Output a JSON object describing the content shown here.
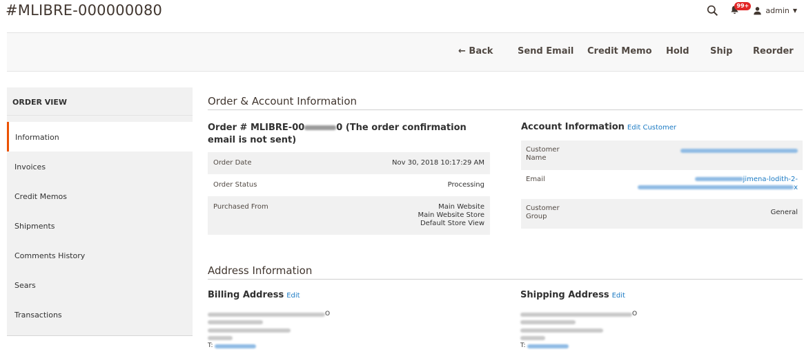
{
  "header": {
    "title": "#MLIBRE-000000080",
    "notification_count": "99+",
    "user_name": "admin",
    "icons": [
      "search-icon",
      "bell-icon",
      "user-icon",
      "caret-down-icon"
    ]
  },
  "toolbar": {
    "back": "Back",
    "send_email": "Send Email",
    "credit_memo": "Credit Memo",
    "hold": "Hold",
    "ship": "Ship",
    "reorder": "Reorder"
  },
  "sidebar": {
    "heading": "ORDER VIEW",
    "items": [
      {
        "label": "Information",
        "active": true
      },
      {
        "label": "Invoices"
      },
      {
        "label": "Credit Memos"
      },
      {
        "label": "Shipments"
      },
      {
        "label": "Comments History"
      },
      {
        "label": "Sears"
      },
      {
        "label": "Transactions"
      }
    ]
  },
  "order_account": {
    "section_title": "Order & Account Information",
    "order_heading_prefix": "Order # MLIBRE-00",
    "order_heading_suffix": "0 (The order confirmation email is not sent)",
    "rows": [
      {
        "label": "Order Date",
        "value": "Nov 30, 2018 10:17:29 AM"
      },
      {
        "label": "Order Status",
        "value": "Processing"
      },
      {
        "label": "Purchased From",
        "value_lines": [
          "Main Website",
          "Main Website Store",
          "Default Store View"
        ]
      }
    ],
    "account_heading": "Account Information",
    "edit_customer": "Edit Customer",
    "account_rows": [
      {
        "label": "Customer Name"
      },
      {
        "label": "Email",
        "visible_fragment_1": "jimena-lodith-2-",
        "visible_fragment_2": "x"
      },
      {
        "label": "Customer Group",
        "value": "General"
      }
    ]
  },
  "address": {
    "section_title": "Address Information",
    "billing_heading": "Billing Address",
    "shipping_heading": "Shipping Address",
    "edit_label": "Edit",
    "billing_name_tail": "O",
    "shipping_name_tail": "O",
    "phone_prefix": "T:"
  },
  "colors": {
    "accent": "#eb5202",
    "link": "#1979c3",
    "badge": "#e22626",
    "row_alt": "#f1f1f1"
  }
}
